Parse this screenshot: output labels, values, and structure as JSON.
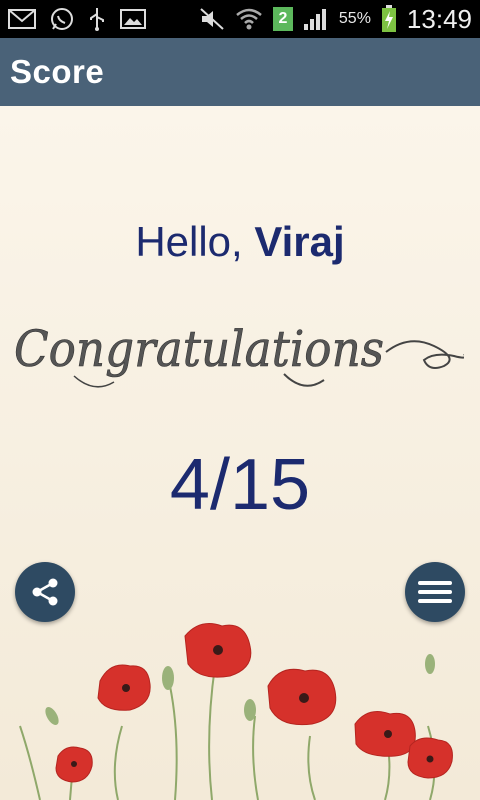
{
  "status_bar": {
    "notification_count": "2",
    "battery_percent": "55%",
    "time": "13:49",
    "icons": [
      "mail-icon",
      "whatsapp-icon",
      "usb-icon",
      "image-icon",
      "mute-icon",
      "wifi-icon",
      "signal-icon",
      "battery-charging-icon"
    ]
  },
  "app_bar": {
    "title": "Score"
  },
  "greeting": {
    "prefix": "Hello, ",
    "name": "Viraj"
  },
  "congrats_text": "Congratulations",
  "score": "4/15",
  "buttons": {
    "share": "share-icon",
    "menu": "menu-icon"
  },
  "colors": {
    "app_bar": "#4a6278",
    "text": "#1c2a6f",
    "button": "#2e4a62",
    "poppy": "#d6312b"
  }
}
